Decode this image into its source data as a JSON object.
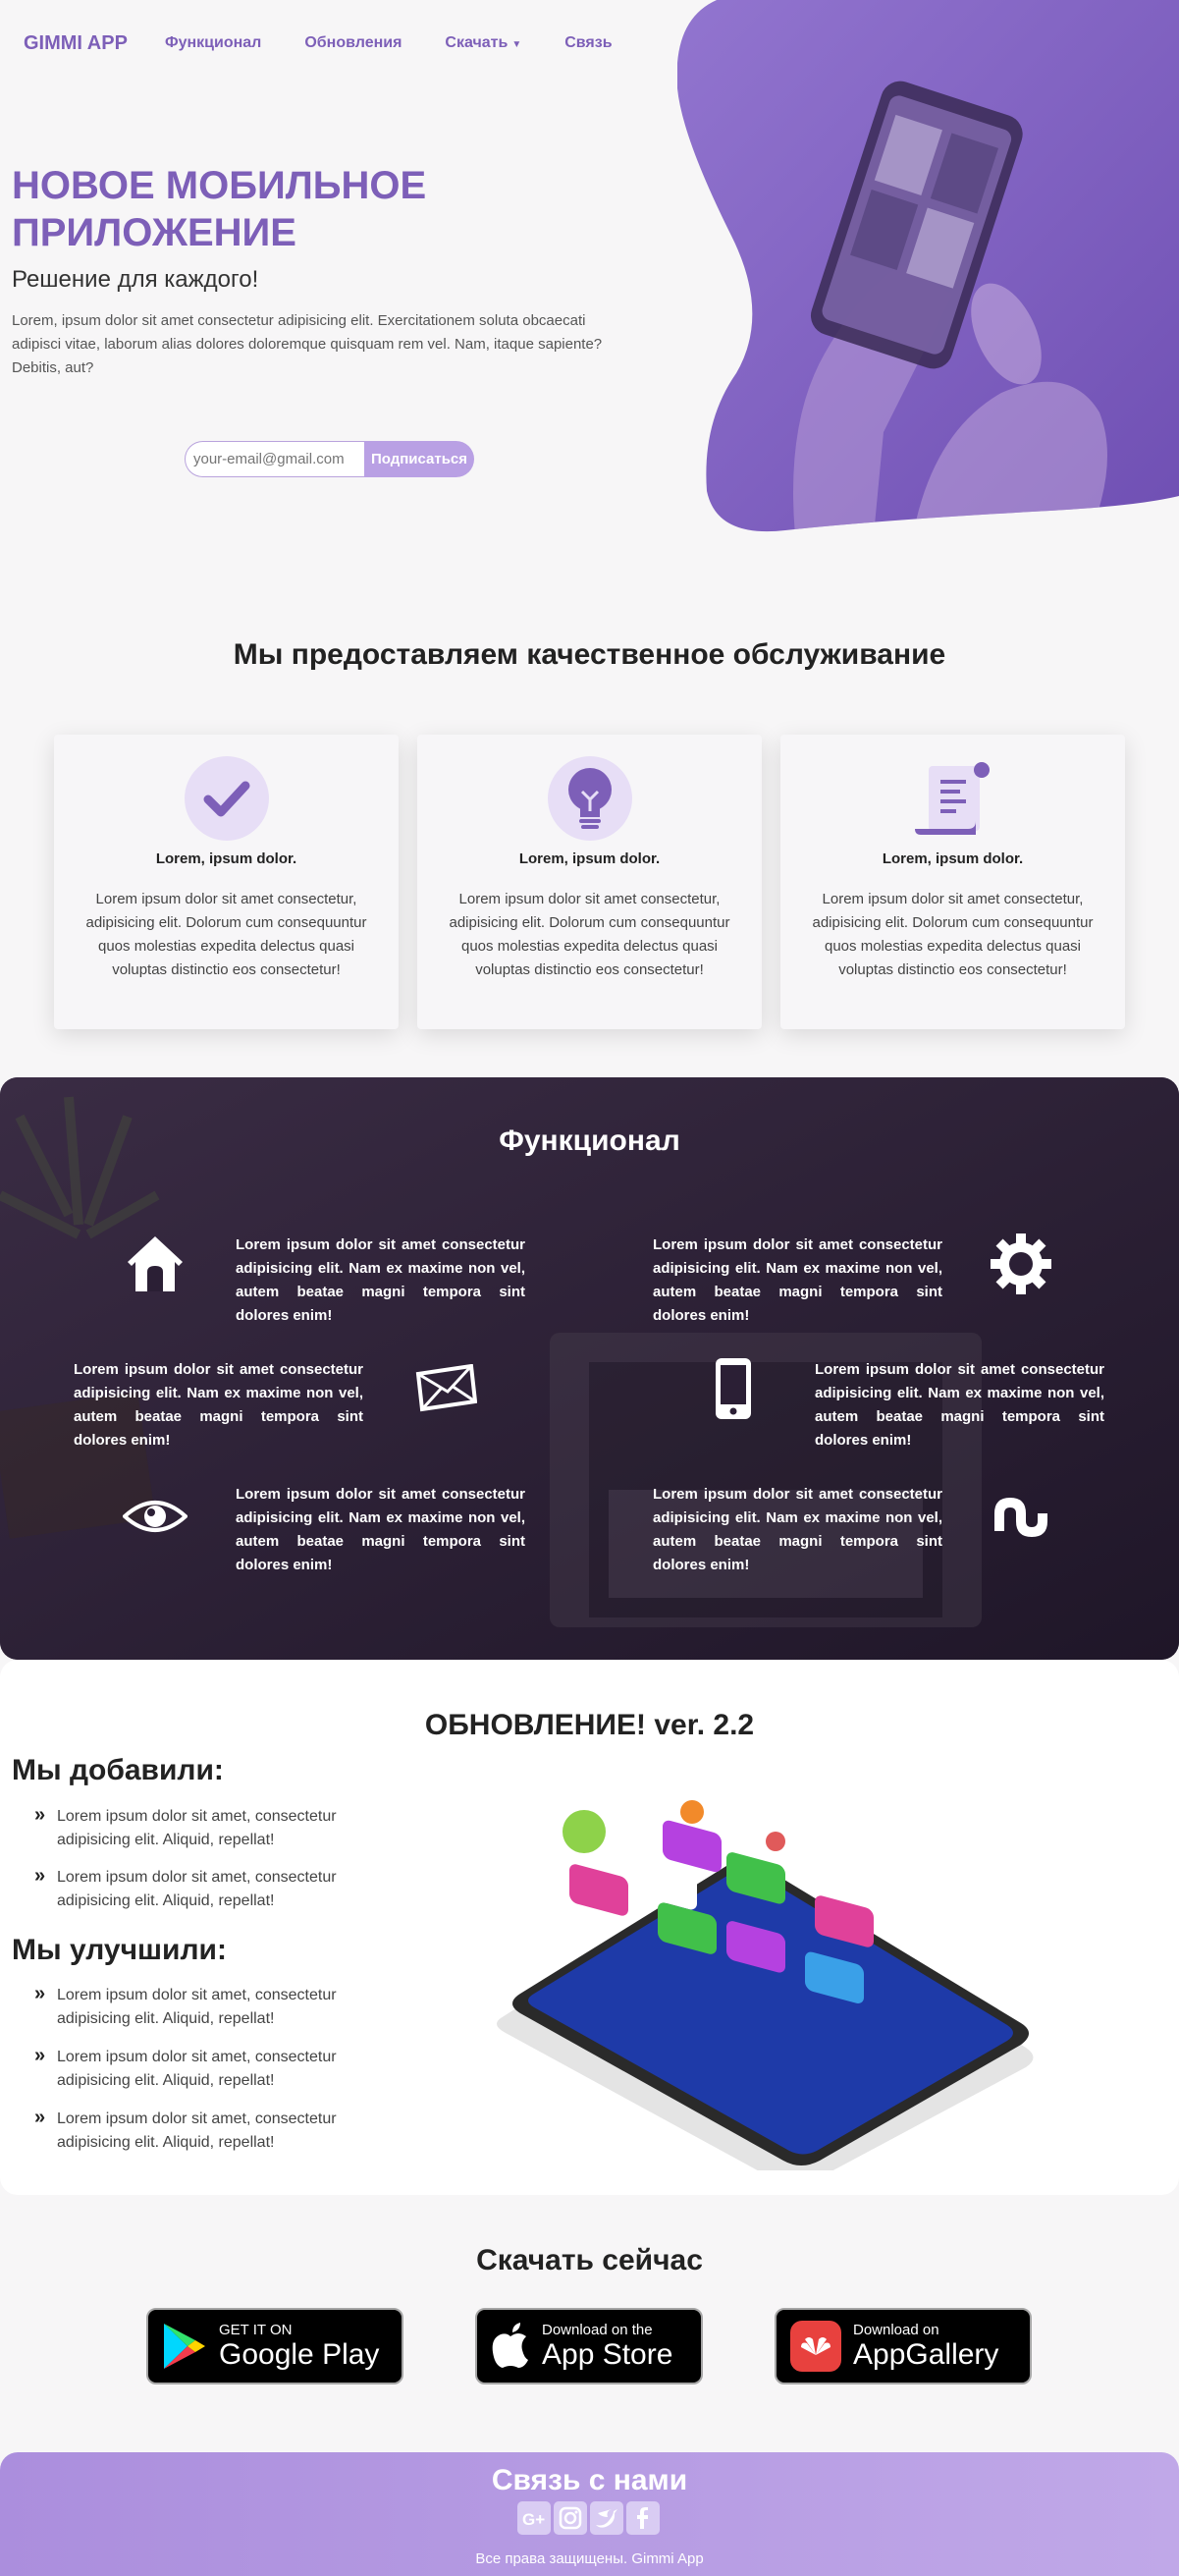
{
  "nav": {
    "brand": "GIMMI APP",
    "links": [
      "Функционал",
      "Обновления",
      "Скачать",
      "Связь"
    ]
  },
  "hero": {
    "title_line1": "НОВОЕ МОБИЛЬНОЕ",
    "title_line2": "ПРИЛОЖЕНИЕ",
    "subtitle": "Решение для каждого!",
    "description": "Lorem, ipsum dolor sit amet consectetur adipisicing elit. Exercitationem soluta obcaecati adipisci vitae, laborum alias dolores doloremque quisquam rem vel. Nam, itaque sapiente? Debitis, aut?",
    "email_placeholder": "your-email@gmail.com",
    "subscribe_label": "Подписаться"
  },
  "services": {
    "title": "Мы предоставляем качественное обслуживание",
    "cards": [
      {
        "icon": "checkmark-icon",
        "title": "Lorem, ipsum dolor.",
        "text": "Lorem ipsum dolor sit amet consectetur, adipisicing elit. Dolorum cum consequuntur quos molestias expedita delectus quasi voluptas distinctio eos consectetur!"
      },
      {
        "icon": "lightbulb-icon",
        "title": "Lorem, ipsum dolor.",
        "text": "Lorem ipsum dolor sit amet consectetur, adipisicing elit. Dolorum cum consequuntur quos molestias expedita delectus quasi voluptas distinctio eos consectetur!"
      },
      {
        "icon": "scroll-icon",
        "title": "Lorem, ipsum dolor.",
        "text": "Lorem ipsum dolor sit amet consectetur, adipisicing elit. Dolorum cum consequuntur quos molestias expedita delectus quasi voluptas distinctio eos consectetur!"
      }
    ]
  },
  "features": {
    "title": "Функционал",
    "items": [
      {
        "icon": "home-icon",
        "text": "Lorem ipsum dolor sit amet consectetur adipisicing elit. Nam ex maxime non vel, autem beatae magni tempora sint dolores enim!"
      },
      {
        "icon": "gear-icon",
        "text": "Lorem ipsum dolor sit amet consectetur adipisicing elit. Nam ex maxime non vel, autem beatae magni tempora sint dolores enim!"
      },
      {
        "icon": "envelope-icon",
        "text": "Lorem ipsum dolor sit amet consectetur adipisicing elit. Nam ex maxime non vel, autem beatae magni tempora sint dolores enim!"
      },
      {
        "icon": "mobile-icon",
        "text": "Lorem ipsum dolor sit amet consectetur adipisicing elit. Nam ex maxime non vel, autem beatae magni tempora sint dolores enim!"
      },
      {
        "icon": "eye-icon",
        "text": "Lorem ipsum dolor sit amet consectetur adipisicing elit. Nam ex maxime non vel, autem beatae magni tempora sint dolores enim!"
      },
      {
        "icon": "stumbleupon-icon",
        "text": "Lorem ipsum dolor sit amet consectetur adipisicing elit. Nam ex maxime non vel, autem beatae magni tempora sint dolores enim!"
      }
    ]
  },
  "update": {
    "title": "ОБНОВЛЕНИЕ! ver. 2.2",
    "added_heading": "Мы добавили:",
    "added_items": [
      "Lorem ipsum dolor sit amet, consectetur adipisicing elit. Aliquid, repellat!",
      "Lorem ipsum dolor sit amet, consectetur adipisicing elit. Aliquid, repellat!"
    ],
    "improved_heading": "Мы улучшили:",
    "improved_items": [
      "Lorem ipsum dolor sit amet, consectetur adipisicing elit. Aliquid, repellat!",
      "Lorem ipsum dolor sit amet, consectetur adipisicing elit. Aliquid, repellat!",
      "Lorem ipsum dolor sit amet, consectetur adipisicing elit. Aliquid, repellat!"
    ]
  },
  "download": {
    "title": "Скачать сейчас",
    "stores": [
      {
        "small": "GET IT ON",
        "big": "Google Play"
      },
      {
        "small": "Download on the",
        "big": "App Store"
      },
      {
        "small": "Download on",
        "big": "AppGallery"
      }
    ]
  },
  "footer": {
    "title": "Связь с нами",
    "socials": [
      "google-plus-icon",
      "instagram-icon",
      "twitter-icon",
      "facebook-icon"
    ],
    "copyright": "Все права защищены. Gimmi App"
  },
  "colors": {
    "brand": "#7d5fb8",
    "accent_light": "#b9a0e4",
    "dark_section": "#2b1f35",
    "footer_gradient_start": "#ab8edd",
    "footer_gradient_end": "#c0a8e8"
  }
}
